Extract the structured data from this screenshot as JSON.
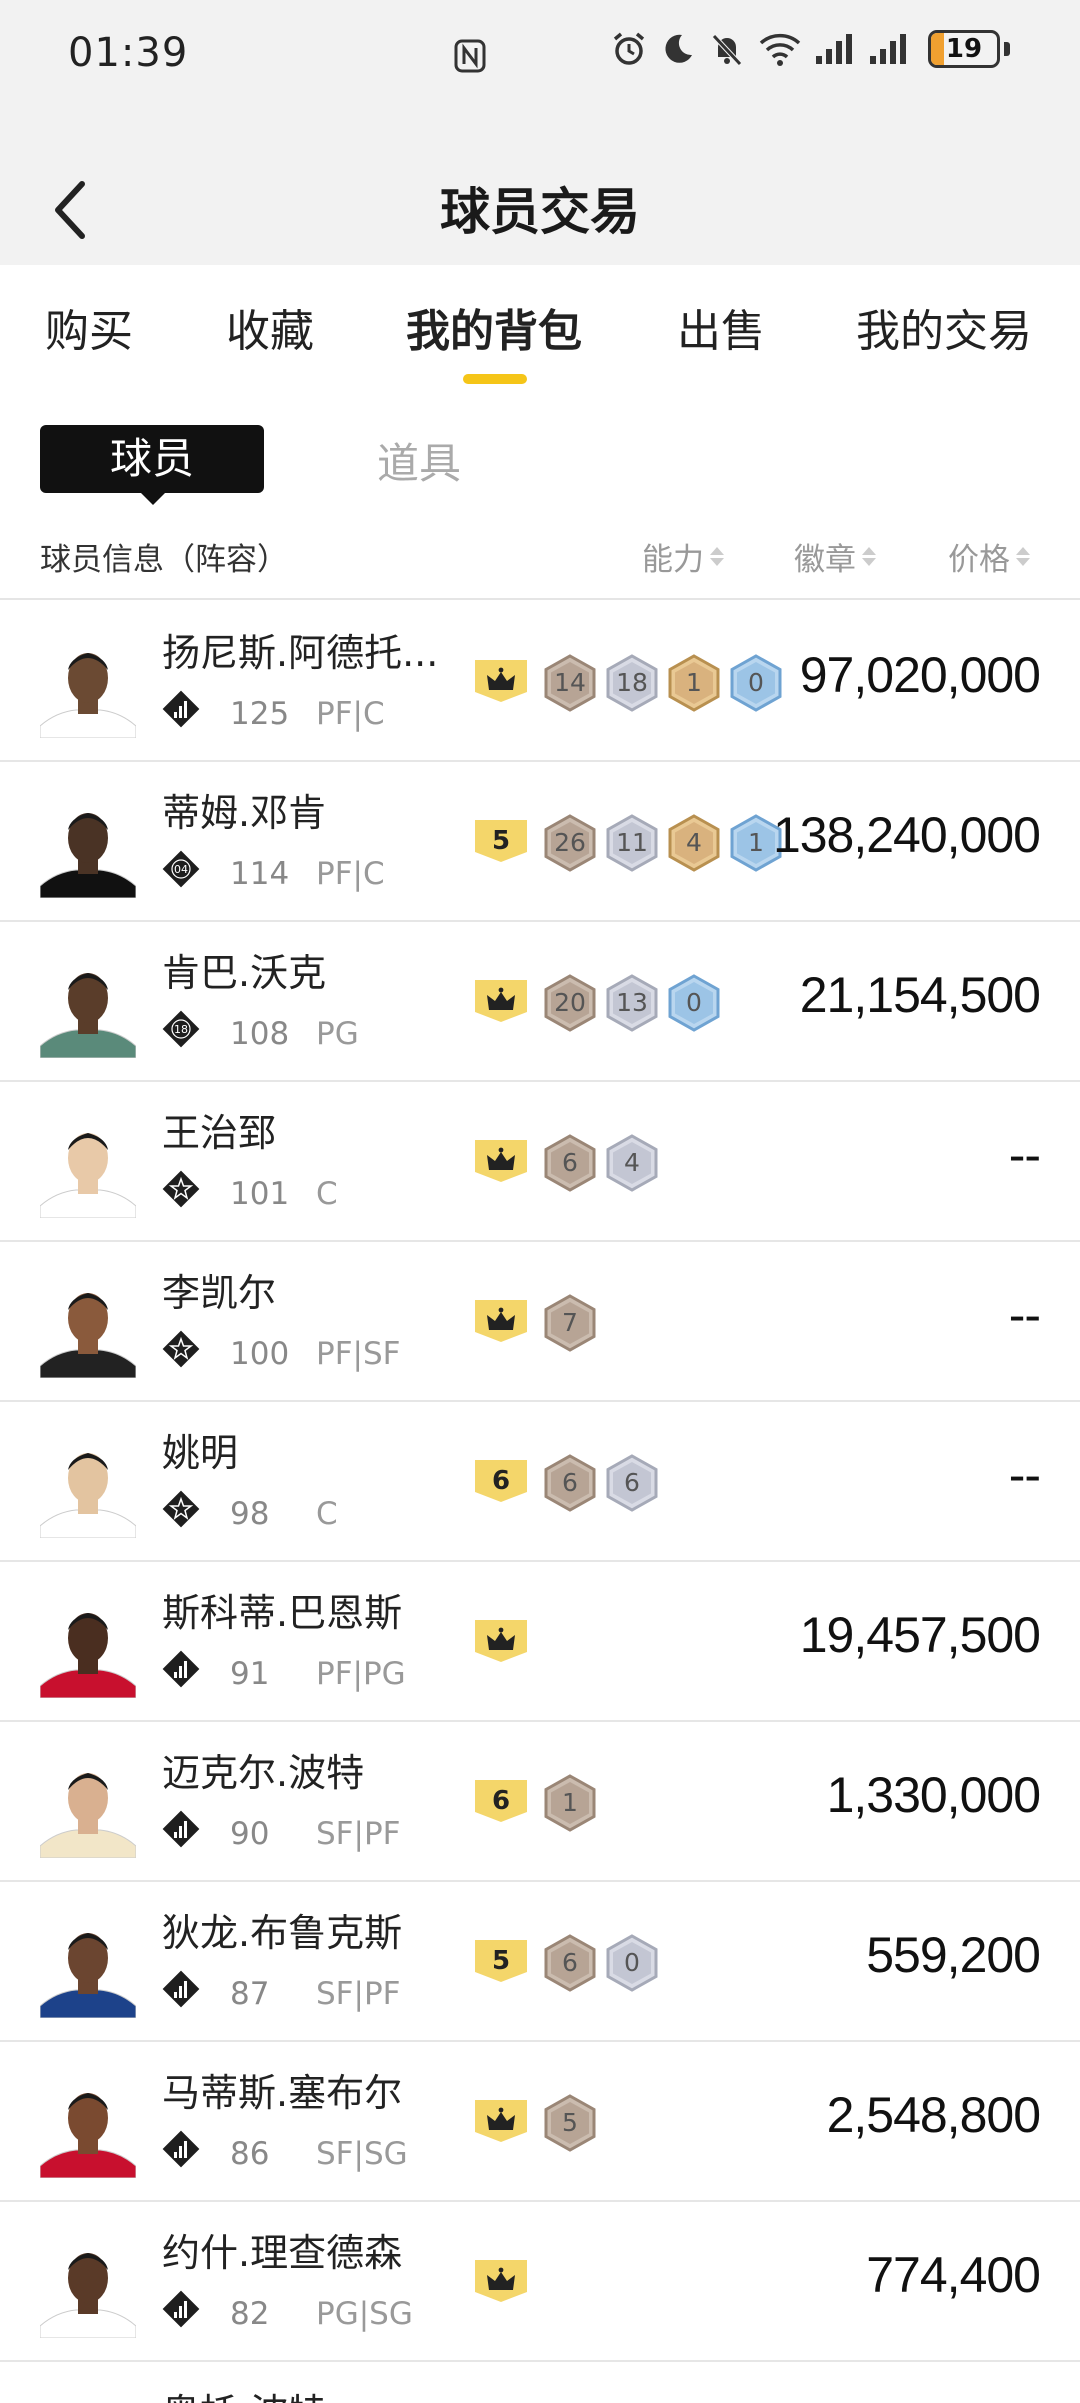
{
  "status": {
    "time": "01:39",
    "battery": "19",
    "battery_level": 0.19
  },
  "header": {
    "title": "球员交易"
  },
  "tabs": [
    {
      "label": "购买"
    },
    {
      "label": "收藏"
    },
    {
      "label": "我的背包",
      "active": true
    },
    {
      "label": "出售"
    },
    {
      "label": "我的交易"
    }
  ],
  "subtabs": {
    "active": "球员",
    "other": "道具"
  },
  "columns": {
    "info": "球员信息（阵容）",
    "ability": "能力",
    "badge": "徽章",
    "price": "价格"
  },
  "colors": {
    "accent": "#f5c518",
    "bronze": "#b7a495",
    "silver": "#c3c6d3",
    "gold": "#d9b27e",
    "blue": "#9cc4e6"
  },
  "players": [
    {
      "name": "扬尼斯.阿德托...",
      "rating": "125",
      "position": "PF|C",
      "team_icon": "chart-icon",
      "tag": "crown",
      "badges": [
        {
          "v": "14",
          "t": "bronze"
        },
        {
          "v": "18",
          "t": "silver"
        },
        {
          "v": "1",
          "t": "gold"
        },
        {
          "v": "0",
          "t": "blue"
        }
      ],
      "price": "97,020,000",
      "skin": "#6b4a33",
      "jersey": "#ffffff"
    },
    {
      "name": "蒂姆.邓肯",
      "rating": "114",
      "position": "PF|C",
      "team_icon": "04",
      "tag": "5",
      "badges": [
        {
          "v": "26",
          "t": "bronze"
        },
        {
          "v": "11",
          "t": "silver"
        },
        {
          "v": "4",
          "t": "gold"
        },
        {
          "v": "1",
          "t": "blue"
        }
      ],
      "price": "138,240,000",
      "skin": "#4a3325",
      "jersey": "#111111"
    },
    {
      "name": "肯巴.沃克",
      "rating": "108",
      "position": "PG",
      "team_icon": "18",
      "tag": "crown",
      "badges": [
        {
          "v": "20",
          "t": "bronze"
        },
        {
          "v": "13",
          "t": "silver"
        },
        {
          "v": "0",
          "t": "blue"
        }
      ],
      "price": "21,154,500",
      "skin": "#5a3d2a",
      "jersey": "#5a8a7a"
    },
    {
      "name": "王治郅",
      "rating": "101",
      "position": "C",
      "team_icon": "star-icon",
      "tag": "crown",
      "badges": [
        {
          "v": "6",
          "t": "bronze"
        },
        {
          "v": "4",
          "t": "silver"
        }
      ],
      "price": "--",
      "skin": "#e8c9a8",
      "jersey": "#ffffff"
    },
    {
      "name": "李凯尔",
      "rating": "100",
      "position": "PF|SF",
      "team_icon": "star-icon",
      "tag": "crown",
      "badges": [
        {
          "v": "7",
          "t": "bronze"
        }
      ],
      "price": "--",
      "skin": "#8a5a3c",
      "jersey": "#222222"
    },
    {
      "name": "姚明",
      "rating": "98",
      "position": "C",
      "team_icon": "star-icon",
      "tag": "6",
      "badges": [
        {
          "v": "6",
          "t": "bronze"
        },
        {
          "v": "6",
          "t": "silver"
        }
      ],
      "price": "--",
      "skin": "#e3c4a0",
      "jersey": "#ffffff"
    },
    {
      "name": "斯科蒂.巴恩斯",
      "rating": "91",
      "position": "PF|PG",
      "team_icon": "chart-icon",
      "tag": "crown",
      "badges": [],
      "price": "19,457,500",
      "skin": "#4a2e20",
      "jersey": "#c8102e"
    },
    {
      "name": "迈克尔.波特",
      "rating": "90",
      "position": "SF|PF",
      "team_icon": "chart-icon",
      "tag": "6",
      "badges": [
        {
          "v": "1",
          "t": "bronze"
        }
      ],
      "price": "1,330,000",
      "skin": "#d9b090",
      "jersey": "#f2e6c8"
    },
    {
      "name": "狄龙.布鲁克斯",
      "rating": "87",
      "position": "SF|PF",
      "team_icon": "chart-icon",
      "tag": "5",
      "badges": [
        {
          "v": "6",
          "t": "bronze"
        },
        {
          "v": "0",
          "t": "silver"
        }
      ],
      "price": "559,200",
      "skin": "#6b4530",
      "jersey": "#1d428a"
    },
    {
      "name": "马蒂斯.塞布尔",
      "rating": "86",
      "position": "SF|SG",
      "team_icon": "chart-icon",
      "tag": "crown",
      "badges": [
        {
          "v": "5",
          "t": "bronze"
        }
      ],
      "price": "2,548,800",
      "skin": "#7a4a30",
      "jersey": "#c8102e"
    },
    {
      "name": "约什.理查德森",
      "rating": "82",
      "position": "PG|SG",
      "team_icon": "chart-icon",
      "tag": "crown",
      "badges": [],
      "price": "774,400",
      "skin": "#5a3a28",
      "jersey": "#ffffff"
    },
    {
      "name": "奥托.波特",
      "rating": "",
      "position": "",
      "team_icon": "chart-icon",
      "tag": "",
      "badges": [],
      "price": "",
      "skin": "#c9a17e",
      "jersey": "#ffffff"
    }
  ]
}
